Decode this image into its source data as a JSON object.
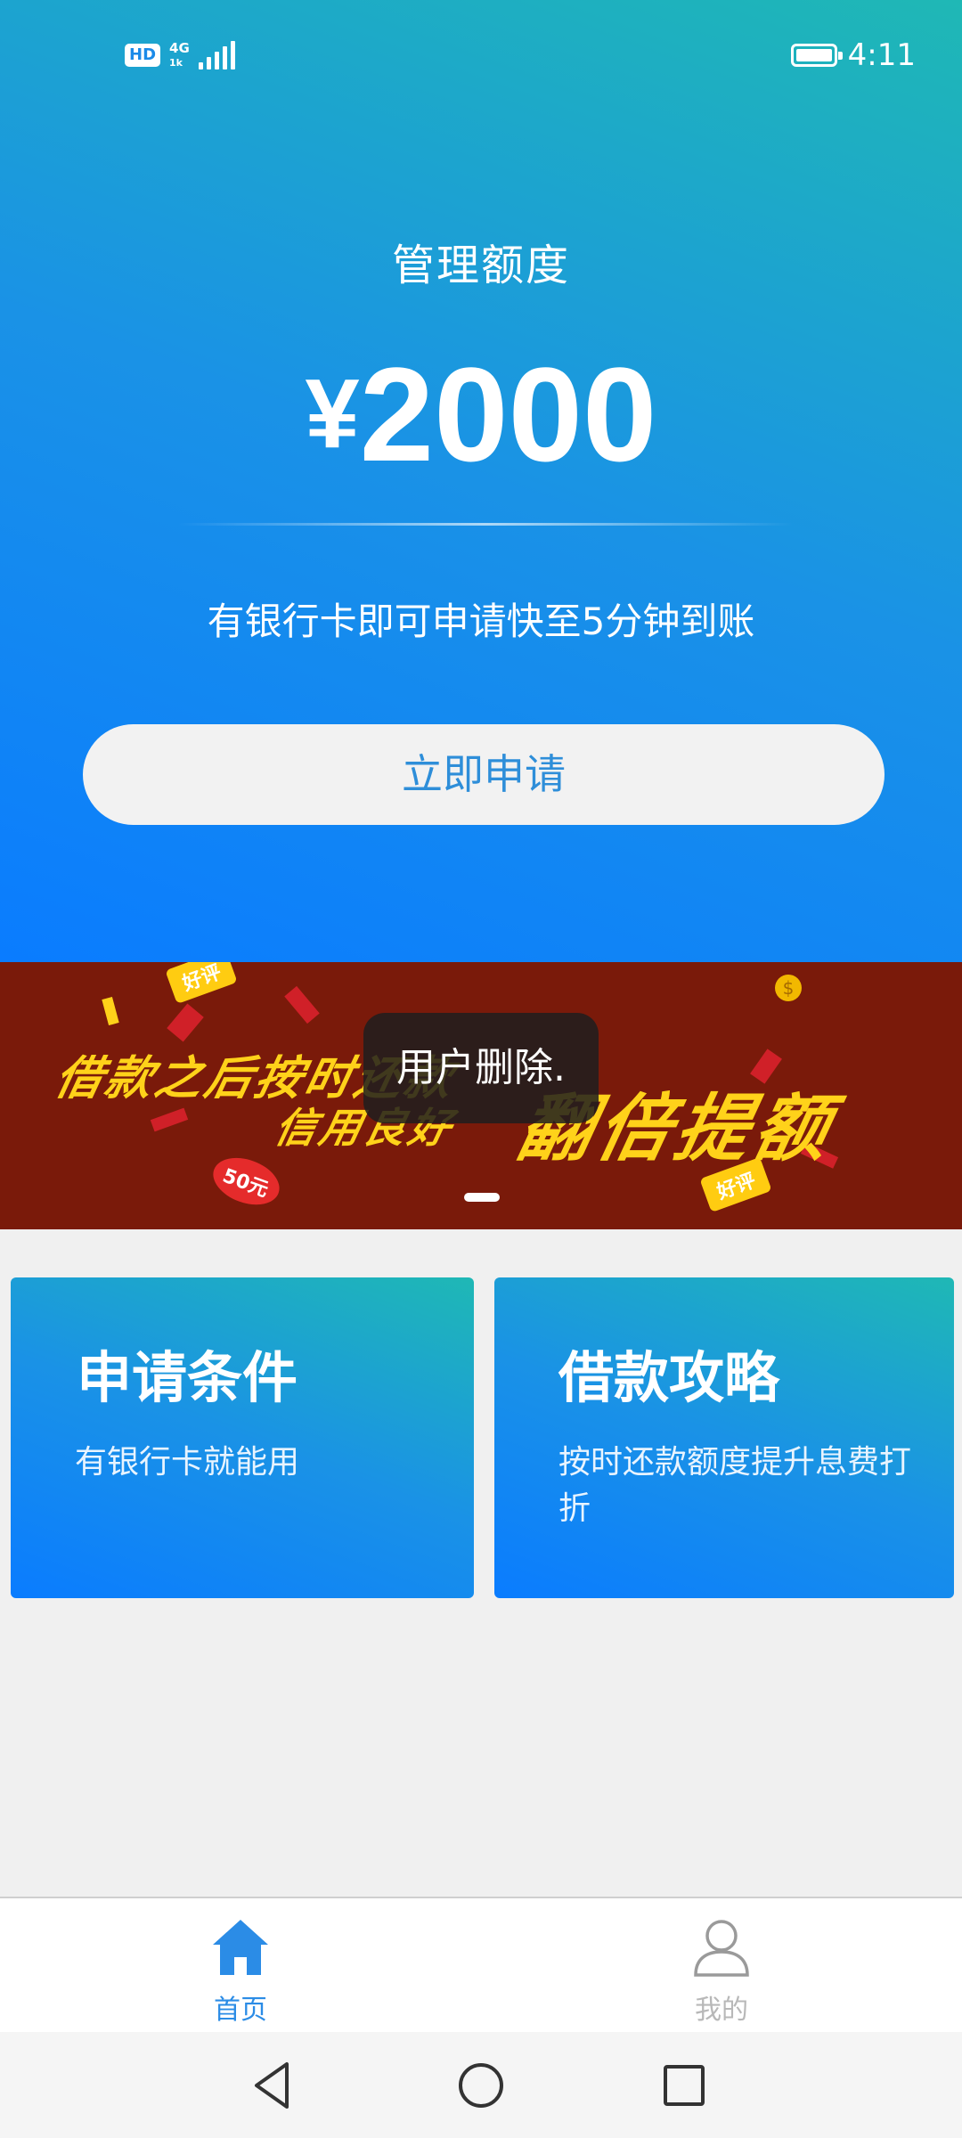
{
  "status_bar": {
    "hd_label": "HD",
    "network_label": "4G",
    "network_sub_label": "1k",
    "signal_icon": "signal-bars-icon",
    "battery_icon": "battery-icon",
    "time": "4:11"
  },
  "hero": {
    "title": "管理额度",
    "currency": "¥",
    "amount": "2000",
    "subtitle": "有银行卡即可申请快至5分钟到账",
    "apply_label": "立即申请",
    "colors": {
      "gradient_start": "#0a7cff",
      "gradient_end": "#1fb8b5",
      "button_text": "#2e8ed9"
    }
  },
  "banner": {
    "line1": "借款之后按时还款",
    "line2": "信用良好",
    "line3": "翻倍提额",
    "tag_good_review": "好评",
    "tag_coupon": "50元",
    "coin_symbol": "$",
    "colors": {
      "background": "#7a1a0a",
      "text": "#ffd21a"
    }
  },
  "toast": {
    "message": "用户删除."
  },
  "cards": [
    {
      "title": "申请条件",
      "description": "有银行卡就能用"
    },
    {
      "title": "借款攻略",
      "description": "按时还款额度提升息费打折"
    }
  ],
  "tab_bar": {
    "tabs": [
      {
        "label": "首页",
        "icon": "home-icon",
        "active": true
      },
      {
        "label": "我的",
        "icon": "user-icon",
        "active": false
      }
    ],
    "colors": {
      "active": "#2b8ce6",
      "inactive": "#b8b8b8"
    }
  },
  "nav_bar": {
    "back_icon": "back-triangle-icon",
    "home_icon": "home-circle-icon",
    "recent_icon": "recent-square-icon"
  }
}
